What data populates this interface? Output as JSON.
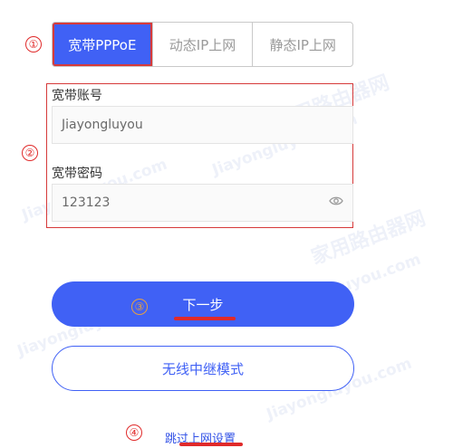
{
  "tabs": [
    {
      "label": "宽带PPPoE",
      "active": true
    },
    {
      "label": "动态IP上网",
      "active": false
    },
    {
      "label": "静态IP上网",
      "active": false
    }
  ],
  "markers": [
    "①",
    "②",
    "③",
    "④"
  ],
  "form": {
    "account_label": "宽带账号",
    "account_value": "Jiayongluyou",
    "password_label": "宽带密码",
    "password_value": "123123",
    "password_icon": "eye-icon"
  },
  "buttons": {
    "next_label": "下一步",
    "repeater_label": "无线中继模式",
    "skip_label": "跳过上网设置"
  },
  "watermark": {
    "brand": "家用路由器网",
    "url": "Jiayongluyou.com"
  },
  "colors": {
    "accent": "#4061f5",
    "annotation": "#e02a2a"
  }
}
